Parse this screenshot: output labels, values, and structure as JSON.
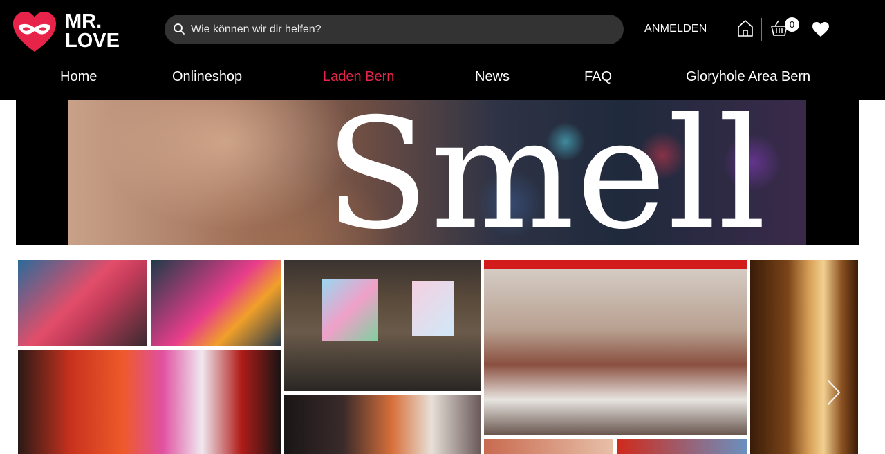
{
  "brand": {
    "line1": "MR.",
    "line2": "LOVE",
    "accent_color": "#e8234a"
  },
  "search": {
    "placeholder": "Wie können wir dir helfen?",
    "value": ""
  },
  "header": {
    "login_label": "ANMELDEN",
    "cart_count": "0"
  },
  "icons": {
    "search": "search-icon",
    "home": "home-icon",
    "cart": "basket-icon",
    "wishlist": "heart-icon",
    "logo": "mask-heart-logo-icon",
    "carousel_next": "chevron-right-icon"
  },
  "nav": [
    {
      "label": "Home",
      "active": false
    },
    {
      "label": "Onlineshop",
      "active": false
    },
    {
      "label": "Laden Bern",
      "active": true
    },
    {
      "label": "News",
      "active": false
    },
    {
      "label": "FAQ",
      "active": false
    },
    {
      "label": "Gloryhole Area Bern",
      "active": false
    }
  ],
  "banner": {
    "title": "Smell"
  }
}
